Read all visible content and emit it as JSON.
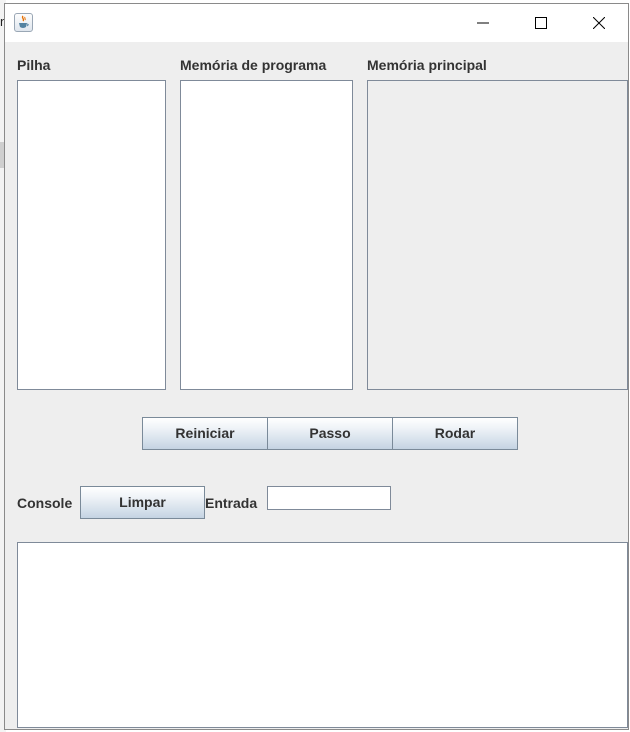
{
  "window": {
    "icon": "java-cup-icon",
    "controls": {
      "minimize": "minimize-icon",
      "maximize": "maximize-icon",
      "close": "close-icon"
    }
  },
  "background_fragment": {
    "text": "n"
  },
  "panels": {
    "stack": {
      "label": "Pilha"
    },
    "program_memory": {
      "label": "Memória de programa"
    },
    "main_memory": {
      "label": "Memória principal"
    }
  },
  "controls": {
    "reset_label": "Reiniciar",
    "step_label": "Passo",
    "run_label": "Rodar"
  },
  "console": {
    "label": "Console",
    "clear_label": "Limpar",
    "input_label": "Entrada",
    "input_value": "",
    "output_text": ""
  },
  "colors": {
    "window_bg": "#eeeeee",
    "border": "#7f8a99",
    "button_gradient_top": "#ffffff",
    "button_gradient_bottom": "#c4d3e2"
  }
}
